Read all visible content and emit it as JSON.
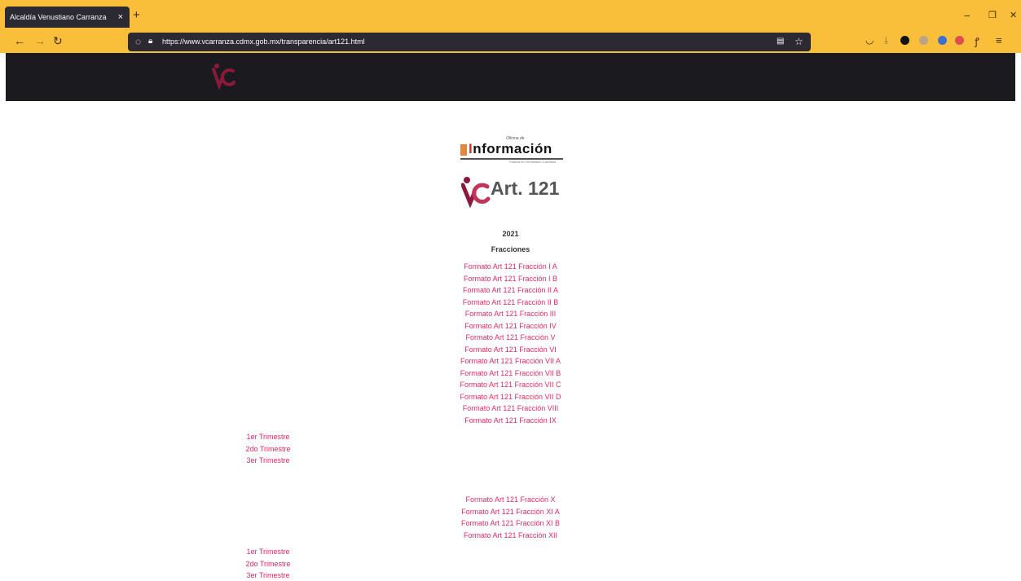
{
  "browser": {
    "tab_title": "Alcaldía Venustiano Carranza",
    "tab_close": "×",
    "new_tab": "+",
    "url": "https://www.vcarranza.cdmx.gob.mx/transparencia/art121.html",
    "window_controls": [
      "−",
      "❐",
      "✕"
    ],
    "nav_icons": [
      "back-arrow-icon",
      "forward-arrow-icon",
      "reload-icon"
    ],
    "accent": "#f9bf3b"
  },
  "header": {
    "logo_text": "VC"
  },
  "brand": {
    "top": "Oficina de",
    "main_i": "I",
    "main_rest": "nformación",
    "sub": "Pública en Venustiano Carranza"
  },
  "page": {
    "title": "Art. 121",
    "year": "2021",
    "fracciones_label": "Fracciones"
  },
  "links_group1": [
    "Formato Art 121 Fracción I A",
    "Formato Art 121 Fracción I B",
    "Formato Art 121 Fracción II A",
    "Formato Art 121 Fracción II B",
    "Formato Art 121 Fracción III",
    "Formato Art 121 Fracción IV",
    "Formato Art 121 Fracción V",
    "Formato Art 121 Fracción VI",
    "Formato Art 121 Fracción VII A",
    "Formato Art 121 Fracción VII B",
    "Formato Art 121 Fracción VII C",
    "Formato Art 121 Fracción VII D",
    "Formato Art 121 Fracción VIII",
    "Formato Art 121 Fracción IX"
  ],
  "trimestres_1": [
    "1er Trimestre",
    "2do Trimestre",
    "3er Trimestre"
  ],
  "links_group2": [
    "Formato Art 121 Fracción X",
    "Formato Art 121 Fracción XI A",
    "Formato Art 121 Fracción XI B",
    "Formato Art 121 Fracción XII"
  ],
  "trimestres_2": [
    "1er Trimestre",
    "2do Trimestre",
    "3er Trimestre"
  ],
  "colors": {
    "link": "#e8285f",
    "logo": "#8b1a3a",
    "header_band": "#1b1b1f"
  }
}
